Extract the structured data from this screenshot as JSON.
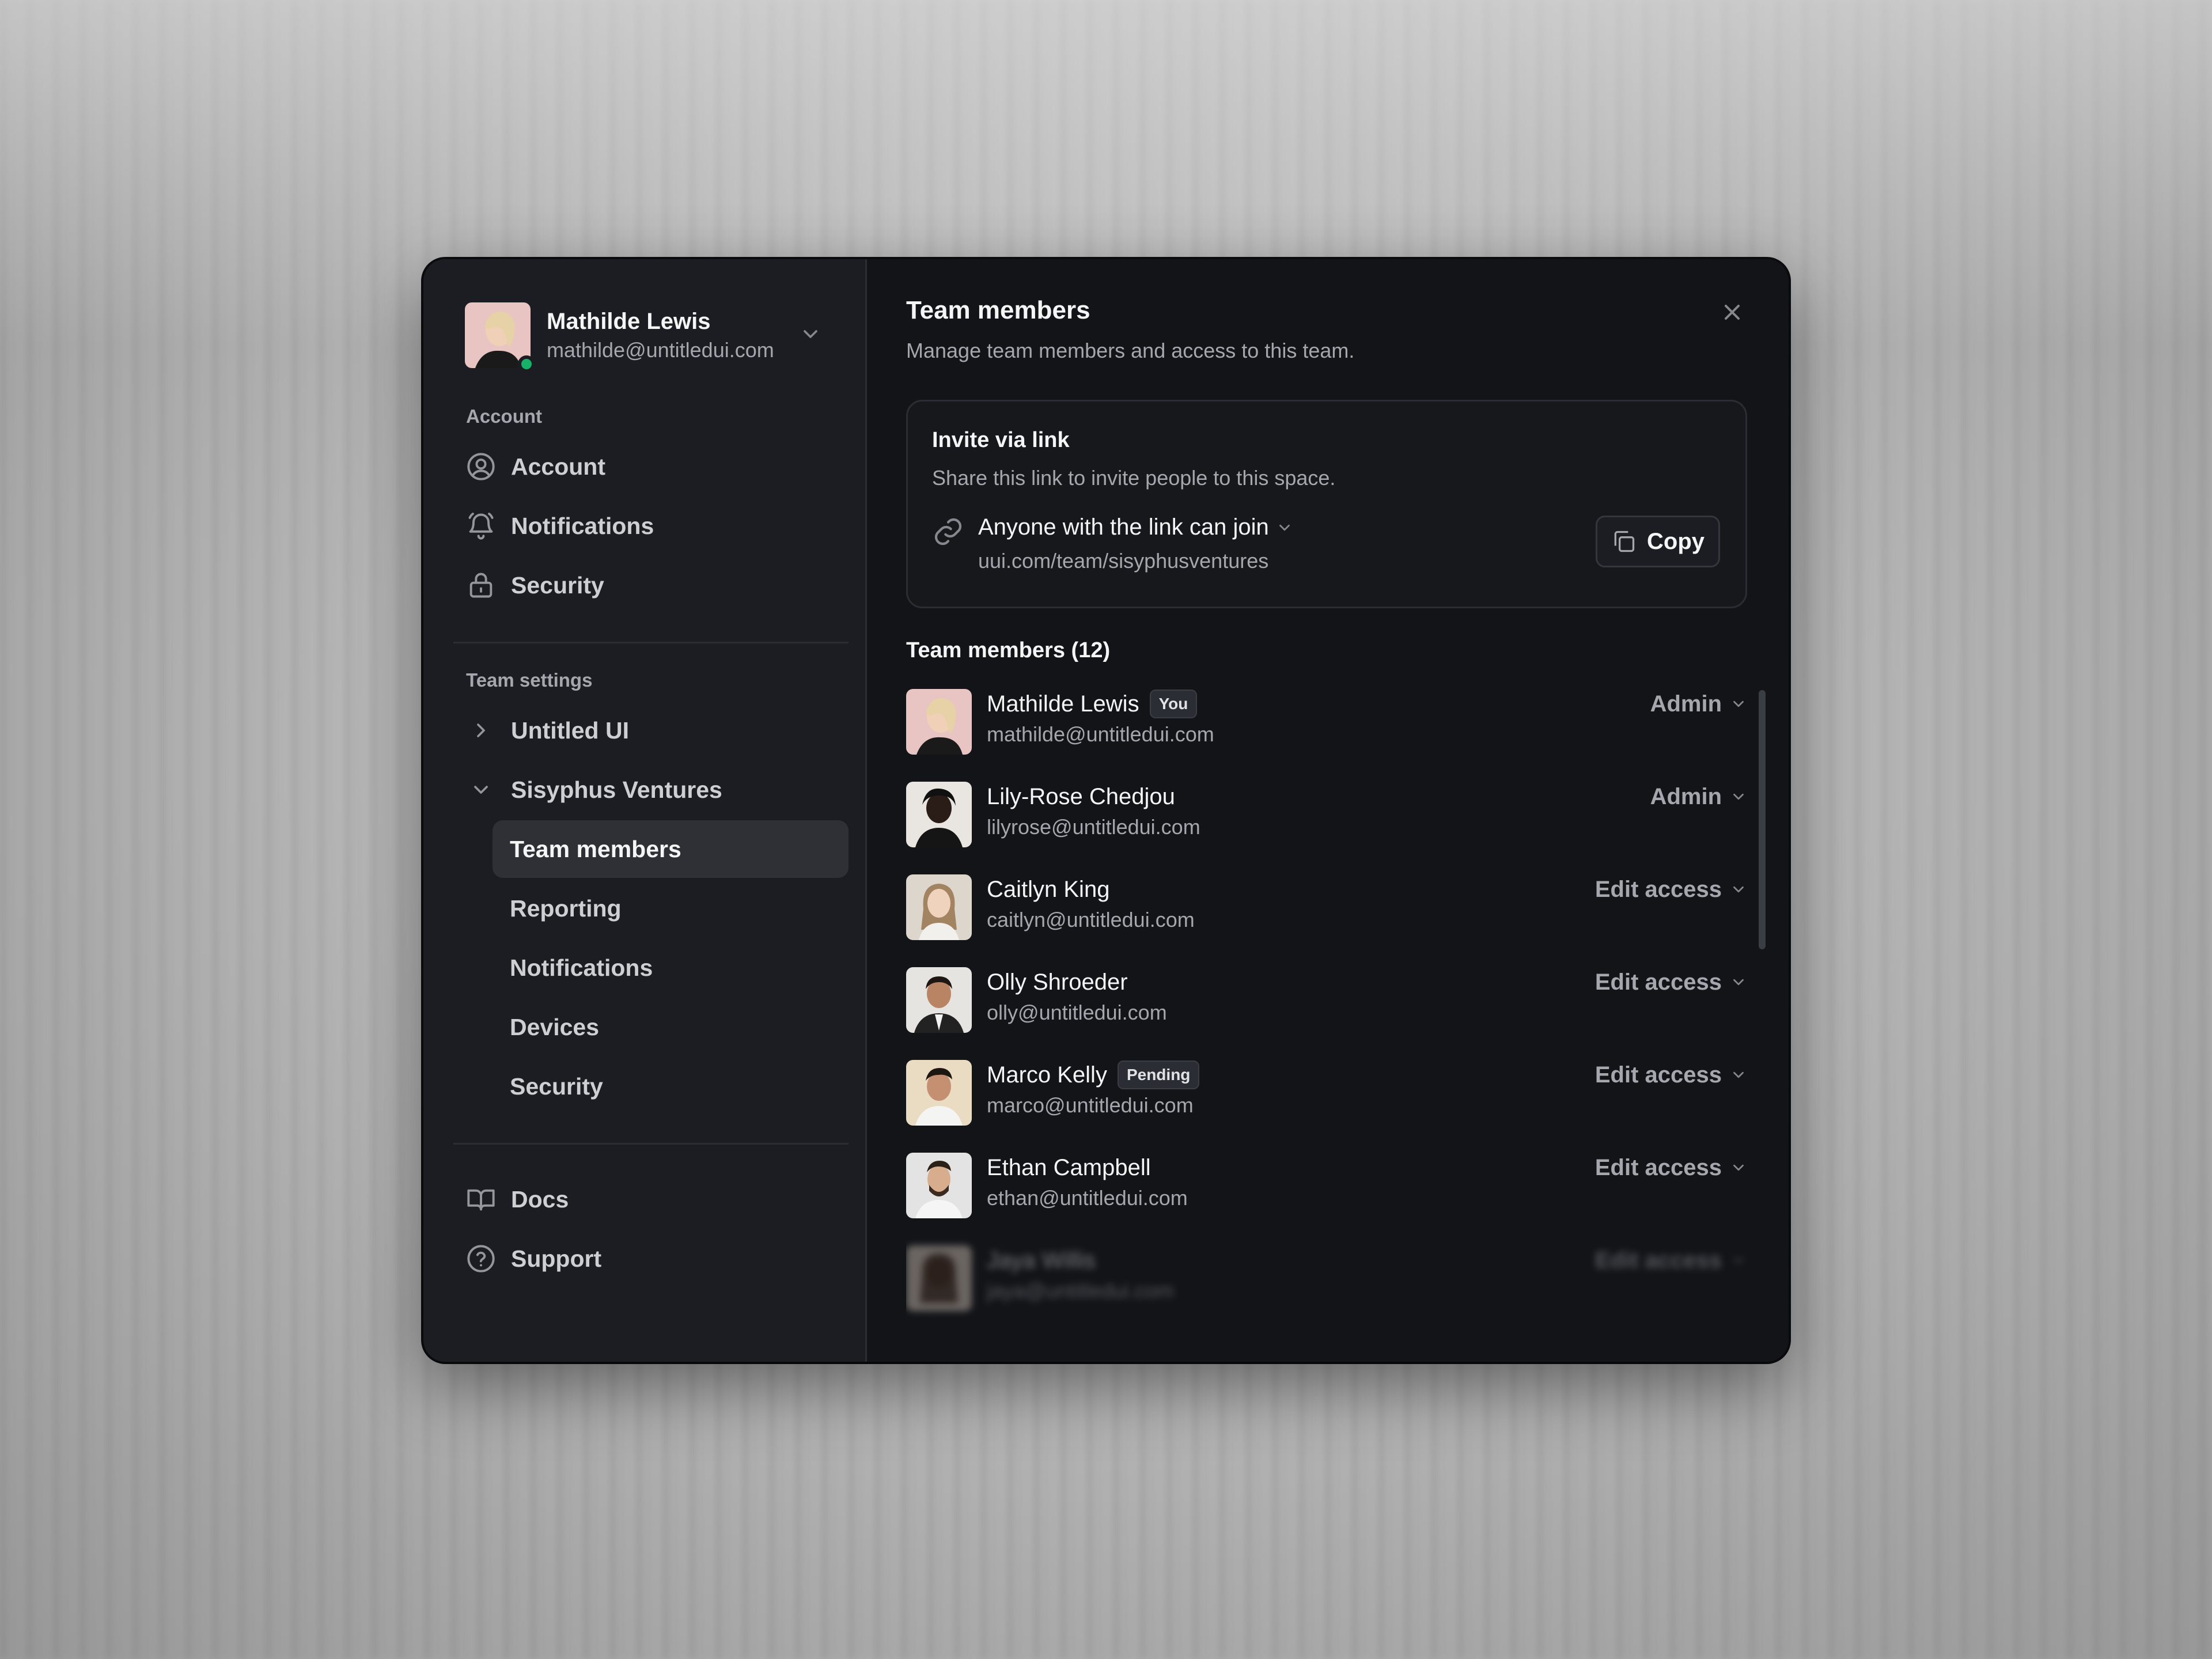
{
  "colors": {
    "online": "#17b26a",
    "modal_bg": "#17191d",
    "sidebar_bg": "#1b1d22",
    "active_item": "#2e3036"
  },
  "user": {
    "name": "Mathilde Lewis",
    "email": "mathilde@untitledui.com"
  },
  "sidebar": {
    "account_label": "Account",
    "account_items": [
      {
        "label": "Account",
        "icon": "user-circle-icon"
      },
      {
        "label": "Notifications",
        "icon": "bell-icon"
      },
      {
        "label": "Security",
        "icon": "lock-icon"
      }
    ],
    "team_label": "Team settings",
    "teams": [
      {
        "label": "Untitled UI",
        "expanded": false
      },
      {
        "label": "Sisyphus Ventures",
        "expanded": true
      }
    ],
    "team_sub_items": [
      {
        "label": "Team members",
        "active": true
      },
      {
        "label": "Reporting"
      },
      {
        "label": "Notifications"
      },
      {
        "label": "Devices"
      },
      {
        "label": "Security"
      }
    ],
    "footer_items": [
      {
        "label": "Docs",
        "icon": "book-icon"
      },
      {
        "label": "Support",
        "icon": "help-circle-icon"
      }
    ]
  },
  "main": {
    "title": "Team members",
    "subtitle": "Manage team members and access to this team.",
    "invite": {
      "title": "Invite via link",
      "description": "Share this link to invite people to this space.",
      "permission": "Anyone with the link can join",
      "url": "uui.com/team/sisyphusventures",
      "copy_label": "Copy"
    },
    "members_header": "Team members (12)",
    "members": [
      {
        "name": "Mathilde Lewis",
        "email": "mathilde@untitledui.com",
        "role": "Admin",
        "badge": "You"
      },
      {
        "name": "Lily-Rose Chedjou",
        "email": "lilyrose@untitledui.com",
        "role": "Admin",
        "badge": ""
      },
      {
        "name": "Caitlyn King",
        "email": "caitlyn@untitledui.com",
        "role": "Edit access",
        "badge": ""
      },
      {
        "name": "Olly Shroeder",
        "email": "olly@untitledui.com",
        "role": "Edit access",
        "badge": ""
      },
      {
        "name": "Marco Kelly",
        "email": "marco@untitledui.com",
        "role": "Edit access",
        "badge": "Pending"
      },
      {
        "name": "Ethan Campbell",
        "email": "ethan@untitledui.com",
        "role": "Edit access",
        "badge": ""
      },
      {
        "name": "Jaya Willis",
        "email": "jaya@untitledui.com",
        "role": "Edit access",
        "badge": ""
      }
    ]
  }
}
